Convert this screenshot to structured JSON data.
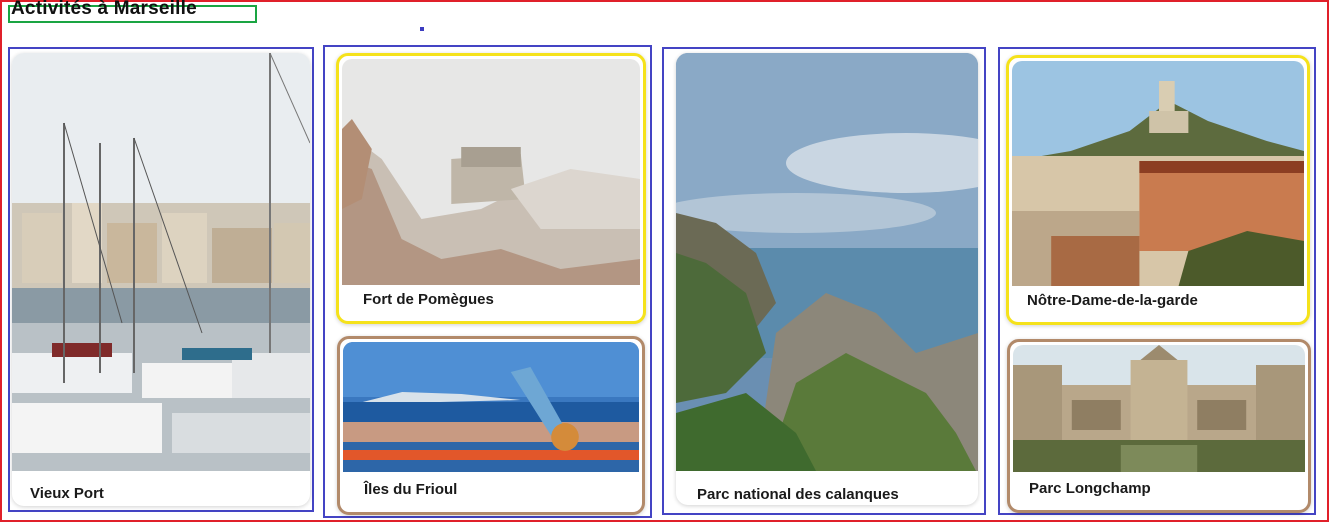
{
  "page": {
    "title": "Activités à Marseille"
  },
  "cards": [
    {
      "label": "Vieux Port"
    },
    {
      "label": "Fort de Pomègues"
    },
    {
      "label": "Îles du Frioul"
    },
    {
      "label": "Parc national des calanques"
    },
    {
      "label": "Nôtre-Dame-de-la-garde"
    },
    {
      "label": "Parc Longchamp"
    }
  ]
}
